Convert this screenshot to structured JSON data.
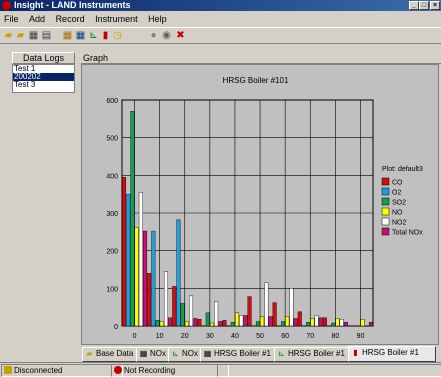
{
  "window": {
    "title": "Insight - LAND Instruments"
  },
  "menu": [
    "File",
    "Add",
    "Record",
    "Instrument",
    "Help"
  ],
  "toolbar": {
    "icons": [
      "new-icon",
      "open-icon",
      "save-icon",
      "print-icon",
      "table-icon",
      "data-grid-icon",
      "line-chart-icon",
      "bar-chart-icon",
      "clock-icon",
      "record-icon",
      "binoculars-icon",
      "stop-icon"
    ]
  },
  "data_logs": {
    "header": "Data Logs",
    "items": [
      "Test 1",
      "200202",
      "Test 3"
    ],
    "selected_index": 1
  },
  "graph_label": "Graph",
  "chart_data": {
    "type": "bar",
    "title": "HRSG Boiler #101",
    "xlabel": "",
    "ylabel": "",
    "ylim": [
      0,
      600
    ],
    "xlim": [
      -5,
      95
    ],
    "y_ticks": [
      0,
      100,
      200,
      300,
      400,
      500,
      600
    ],
    "x_ticks": [
      0,
      10,
      20,
      30,
      40,
      50,
      60,
      70,
      80,
      90
    ],
    "legend_title": "Plot: default3",
    "legend_position": "right",
    "grid": true,
    "categories": [
      0,
      10,
      20,
      30,
      40,
      50,
      60,
      70,
      80,
      90
    ],
    "series": [
      {
        "name": "CO",
        "color": "#d01010",
        "values": [
          395,
          140,
          105,
          18,
          15,
          78,
          62,
          38,
          22,
          0
        ]
      },
      {
        "name": "O2",
        "color": "#1ea0e0",
        "values": [
          350,
          252,
          282,
          0,
          0,
          0,
          0,
          0,
          0,
          0
        ]
      },
      {
        "name": "SO2",
        "color": "#10a050",
        "values": [
          570,
          15,
          60,
          35,
          10,
          12,
          12,
          10,
          8,
          0
        ]
      },
      {
        "name": "NO",
        "color": "#ffff00",
        "values": [
          262,
          12,
          12,
          8,
          35,
          25,
          25,
          20,
          20,
          18
        ]
      },
      {
        "name": "NO2",
        "color": "#ffffff",
        "values": [
          355,
          145,
          80,
          65,
          28,
          115,
          100,
          28,
          18,
          0
        ]
      },
      {
        "name": "Total NOx",
        "color": "#c8106e",
        "values": [
          252,
          22,
          20,
          12,
          28,
          25,
          20,
          22,
          10,
          10
        ]
      }
    ]
  },
  "tabs": [
    {
      "label": "Base Data",
      "icon": "base-data-icon"
    },
    {
      "label": "NOx",
      "icon": "table-icon"
    },
    {
      "label": "NOx",
      "icon": "line-chart-icon"
    },
    {
      "label": "HRSG Boiler #1",
      "icon": "table-icon"
    },
    {
      "label": "HRSG Boiler #1",
      "icon": "line-chart-icon"
    },
    {
      "label": "HRSG Boiler #1",
      "icon": "bar-chart-icon"
    }
  ],
  "active_tab": 5,
  "status": {
    "connection": "Disconnected",
    "recording": "Not Recording"
  }
}
